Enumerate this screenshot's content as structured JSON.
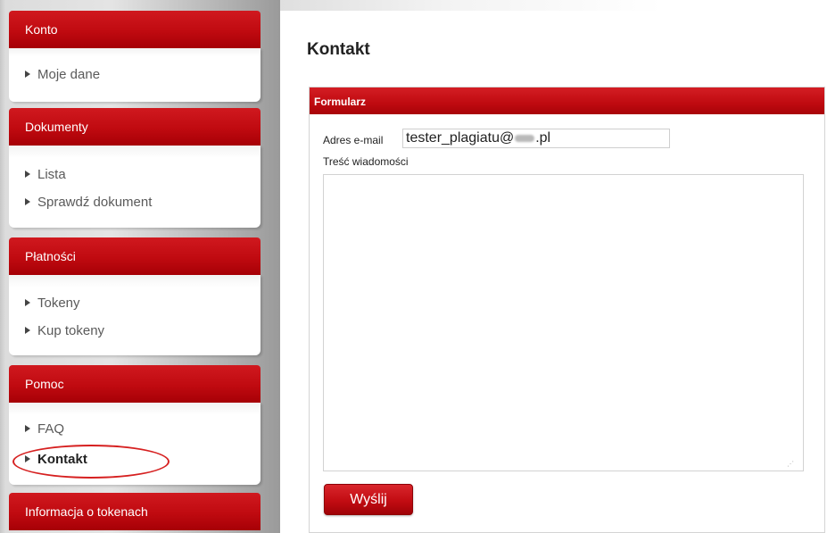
{
  "sidebar": {
    "sections": [
      {
        "title": "Konto",
        "items": [
          {
            "label": "Moje dane"
          }
        ]
      },
      {
        "title": "Dokumenty",
        "items": [
          {
            "label": "Lista"
          },
          {
            "label": "Sprawdź dokument"
          }
        ]
      },
      {
        "title": "Płatności",
        "items": [
          {
            "label": "Tokeny"
          },
          {
            "label": "Kup tokeny"
          }
        ]
      },
      {
        "title": "Pomoc",
        "items": [
          {
            "label": "FAQ"
          },
          {
            "label": "Kontakt"
          }
        ]
      },
      {
        "title": "Informacja o tokenach",
        "items": []
      }
    ],
    "active_item": "Kontakt"
  },
  "main": {
    "title": "Kontakt",
    "form": {
      "header": "Formularz",
      "email_label": "Adres e-mail",
      "email_value_prefix": "tester_plagiatu@",
      "email_value_suffix": ".pl",
      "message_label": "Treść wiadomości",
      "message_value": "",
      "submit_label": "Wyślij"
    }
  },
  "colors": {
    "accent_red": "#c00a10",
    "highlight_oval": "#d62020"
  }
}
